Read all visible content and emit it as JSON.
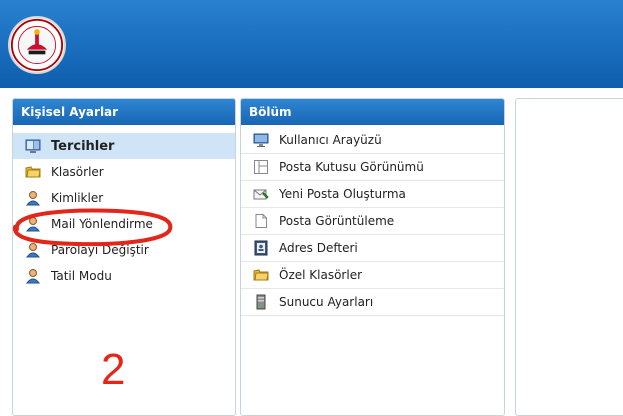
{
  "header": {
    "logo_icon": "meb-emblem-icon"
  },
  "left_panel": {
    "title": "Kişisel Ayarlar",
    "items": [
      {
        "label": "Tercihler",
        "icon": "preferences-icon",
        "selected": true
      },
      {
        "label": "Klasörler",
        "icon": "folders-icon"
      },
      {
        "label": "Kimlikler",
        "icon": "user-icon"
      },
      {
        "label": "Mail Yönlendirme",
        "icon": "user-icon"
      },
      {
        "label": "Parolayı Değiştir",
        "icon": "user-icon"
      },
      {
        "label": "Tatil Modu",
        "icon": "user-icon"
      }
    ]
  },
  "mid_panel": {
    "title": "Bölüm",
    "items": [
      {
        "label": "Kullanıcı Arayüzü",
        "icon": "monitor-icon"
      },
      {
        "label": "Posta Kutusu Görünümü",
        "icon": "layout-icon"
      },
      {
        "label": "Yeni Posta Oluşturma",
        "icon": "compose-mail-icon"
      },
      {
        "label": "Posta Görüntüleme",
        "icon": "document-icon"
      },
      {
        "label": "Adres Defteri",
        "icon": "address-book-icon"
      },
      {
        "label": "Özel Klasörler",
        "icon": "folders-icon"
      },
      {
        "label": "Sunucu Ayarları",
        "icon": "server-icon"
      }
    ]
  },
  "annotation": {
    "number": "2",
    "color": "#e3261a"
  },
  "colors": {
    "header_blue": "#1a6fbe",
    "selected_bg": "#cfe4f7"
  }
}
